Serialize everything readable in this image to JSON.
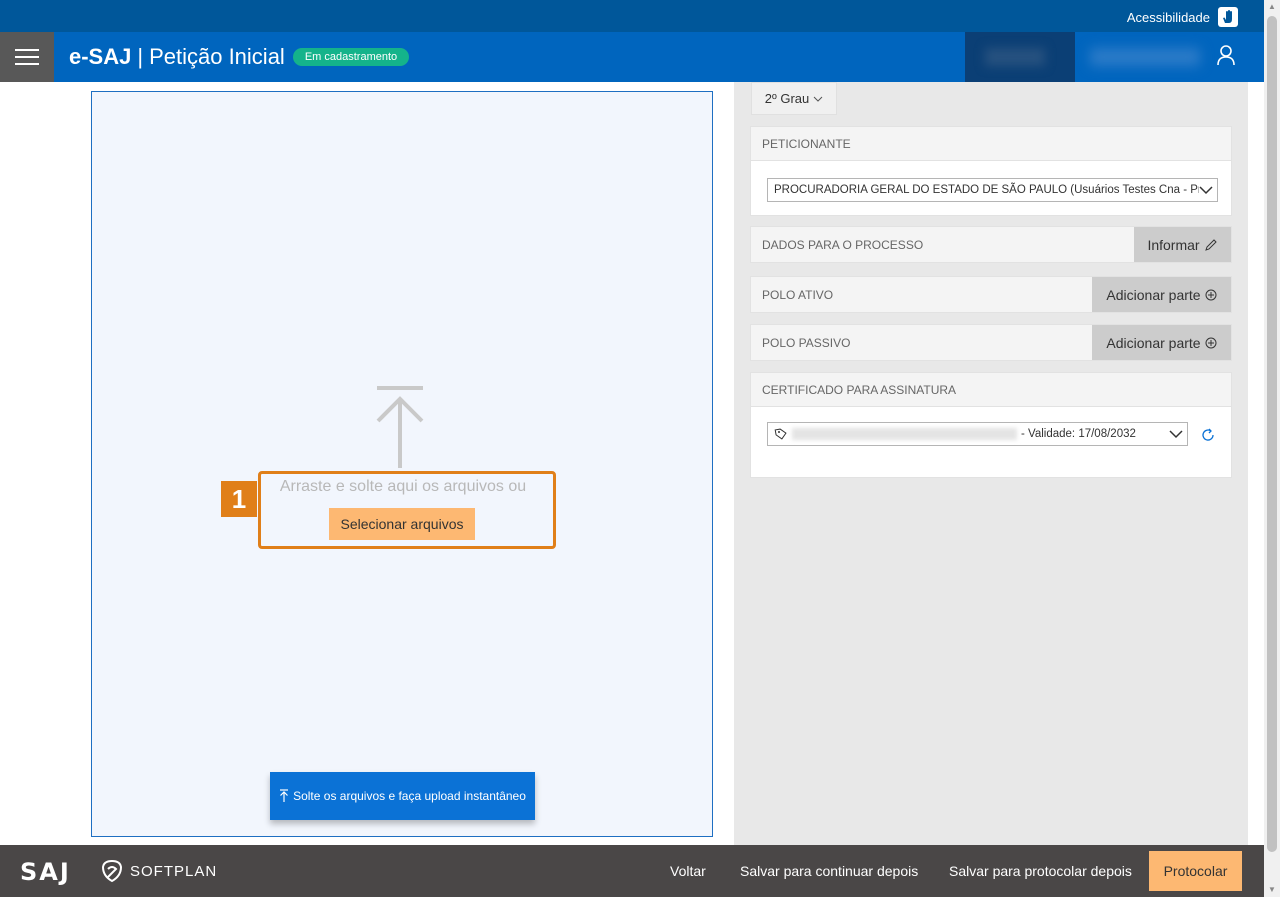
{
  "accessibility": {
    "label": "Acessibilidade"
  },
  "header": {
    "brand": "e-SAJ",
    "separator": "|",
    "title": "Petição Inicial",
    "status_badge": "Em cadastramento"
  },
  "upload": {
    "drop_text": "Arraste e solte aqui os arquivos ou",
    "select_label": "Selecionar arquivos",
    "step_number": "1",
    "instant_upload_label": "Solte os arquivos e faça upload instantâneo"
  },
  "panel": {
    "grau": "2º Grau",
    "peticionante": {
      "header": "PETICIONANTE",
      "value": "PROCURADORIA GERAL DO ESTADO DE SÃO PAULO (Usuários Testes Cna - Pro"
    },
    "dados_processo": {
      "label": "DADOS PARA O PROCESSO",
      "button": "Informar"
    },
    "polo_ativo": {
      "label": "POLO ATIVO",
      "button": "Adicionar parte"
    },
    "polo_passivo": {
      "label": "POLO PASSIVO",
      "button": "Adicionar parte"
    },
    "certificado": {
      "header": "CERTIFICADO PARA ASSINATURA",
      "value": "- Validade: 17/08/2032"
    }
  },
  "footer": {
    "saj_logo": "SAJ",
    "softplan_logo": "SOFTPLAN",
    "voltar": "Voltar",
    "salvar_continuar": "Salvar para continuar depois",
    "salvar_protocolar": "Salvar para protocolar depois",
    "protocolar": "Protocolar"
  }
}
